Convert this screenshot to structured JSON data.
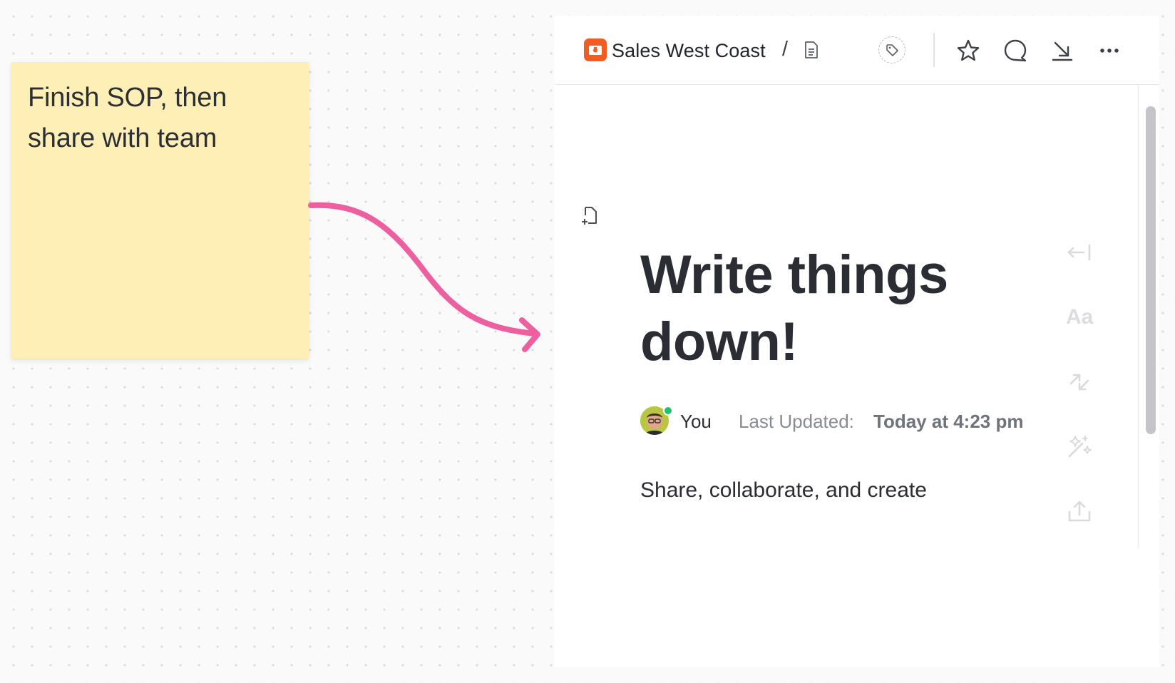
{
  "sticky_note": {
    "text": "Finish SOP, then\nshare with team"
  },
  "breadcrumb": {
    "space_name": "Sales West Coast",
    "separator": "/"
  },
  "document": {
    "title": "Write things down!",
    "author": "You",
    "last_updated_label": "Last Updated:",
    "last_updated_value": "Today at 4:23 pm",
    "body": "Share, collaborate, and create"
  },
  "colors": {
    "sticky_bg": "#fdefb5",
    "arrow": "#ee5fa0",
    "space_badge": "#f25c22",
    "online": "#1fc36f"
  },
  "icons": {
    "topbar": [
      "tag-icon",
      "star-icon",
      "comment-icon",
      "download-icon",
      "more-icon"
    ],
    "sidebar": [
      "collapse-icon",
      "typography-icon",
      "arrows-icon",
      "magic-icon",
      "share-icon"
    ]
  }
}
